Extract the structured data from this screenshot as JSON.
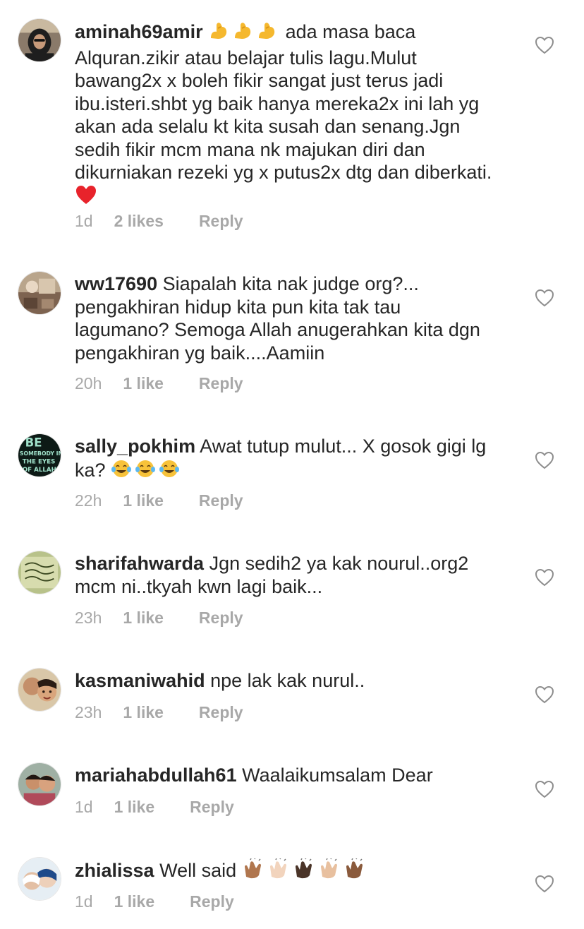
{
  "comments": [
    {
      "username": "aminah69amir",
      "text": "ada masa baca Alquran.zikir atau belajar tulis lagu.Mulut bawang2x x boleh fikir sangat just terus jadi ibu.isteri.shbt yg baik hanya mereka2x ini lah yg akan ada selalu kt kita susah dan senang.Jgn sedih fikir mcm mana nk  majukan diri dan dikurniakan rezeki yg x putus2x dtg dan diberkati.",
      "time": "1d",
      "likes": "2 likes",
      "reply": "Reply",
      "emoji_before": [
        "flexed-biceps-icon",
        "flexed-biceps-icon",
        "flexed-biceps-icon"
      ],
      "emoji_after": [
        "red-heart-icon"
      ]
    },
    {
      "username": "ww17690",
      "text": "Siapalah kita nak judge org?... pengakhiran hidup kita pun kita tak tau lagumano? Semoga Allah anugerahkan kita dgn pengakhiran yg baik....Aamiin",
      "time": "20h",
      "likes": "1 like",
      "reply": "Reply"
    },
    {
      "username": "sally_pokhim",
      "text": "Awat tutup mulut... X gosok gigi lg ka?",
      "time": "22h",
      "likes": "1 like",
      "reply": "Reply",
      "emoji_after": [
        "tears-of-joy-icon",
        "tears-of-joy-icon",
        "tears-of-joy-icon"
      ],
      "avatar_text": [
        "BE",
        "SOMEBODY IN",
        "THE EYES",
        "OF ALLAH"
      ]
    },
    {
      "username": "sharifahwarda",
      "text": "Jgn sedih2 ya kak nourul..org2 mcm ni..tkyah kwn lagi baik...",
      "time": "23h",
      "likes": "1 like",
      "reply": "Reply"
    },
    {
      "username": "kasmaniwahid",
      "text": "npe lak kak nurul..",
      "time": "23h",
      "likes": "1 like",
      "reply": "Reply"
    },
    {
      "username": "mariahabdullah61",
      "text": "Waalaikumsalam Dear",
      "time": "1d",
      "likes": "1 like",
      "reply": "Reply"
    },
    {
      "username": "zhialissa",
      "text": "Well said",
      "time": "1d",
      "likes": "1 like",
      "reply": "Reply",
      "emoji_after": [
        "clapping-hands-icon",
        "clapping-hands-icon",
        "clapping-hands-icon",
        "clapping-hands-icon",
        "clapping-hands-icon"
      ]
    }
  ],
  "colors": {
    "text": "#262626",
    "meta": "#a8a8a8",
    "heart_outline": "#8e8e8e",
    "background": "#ffffff"
  }
}
